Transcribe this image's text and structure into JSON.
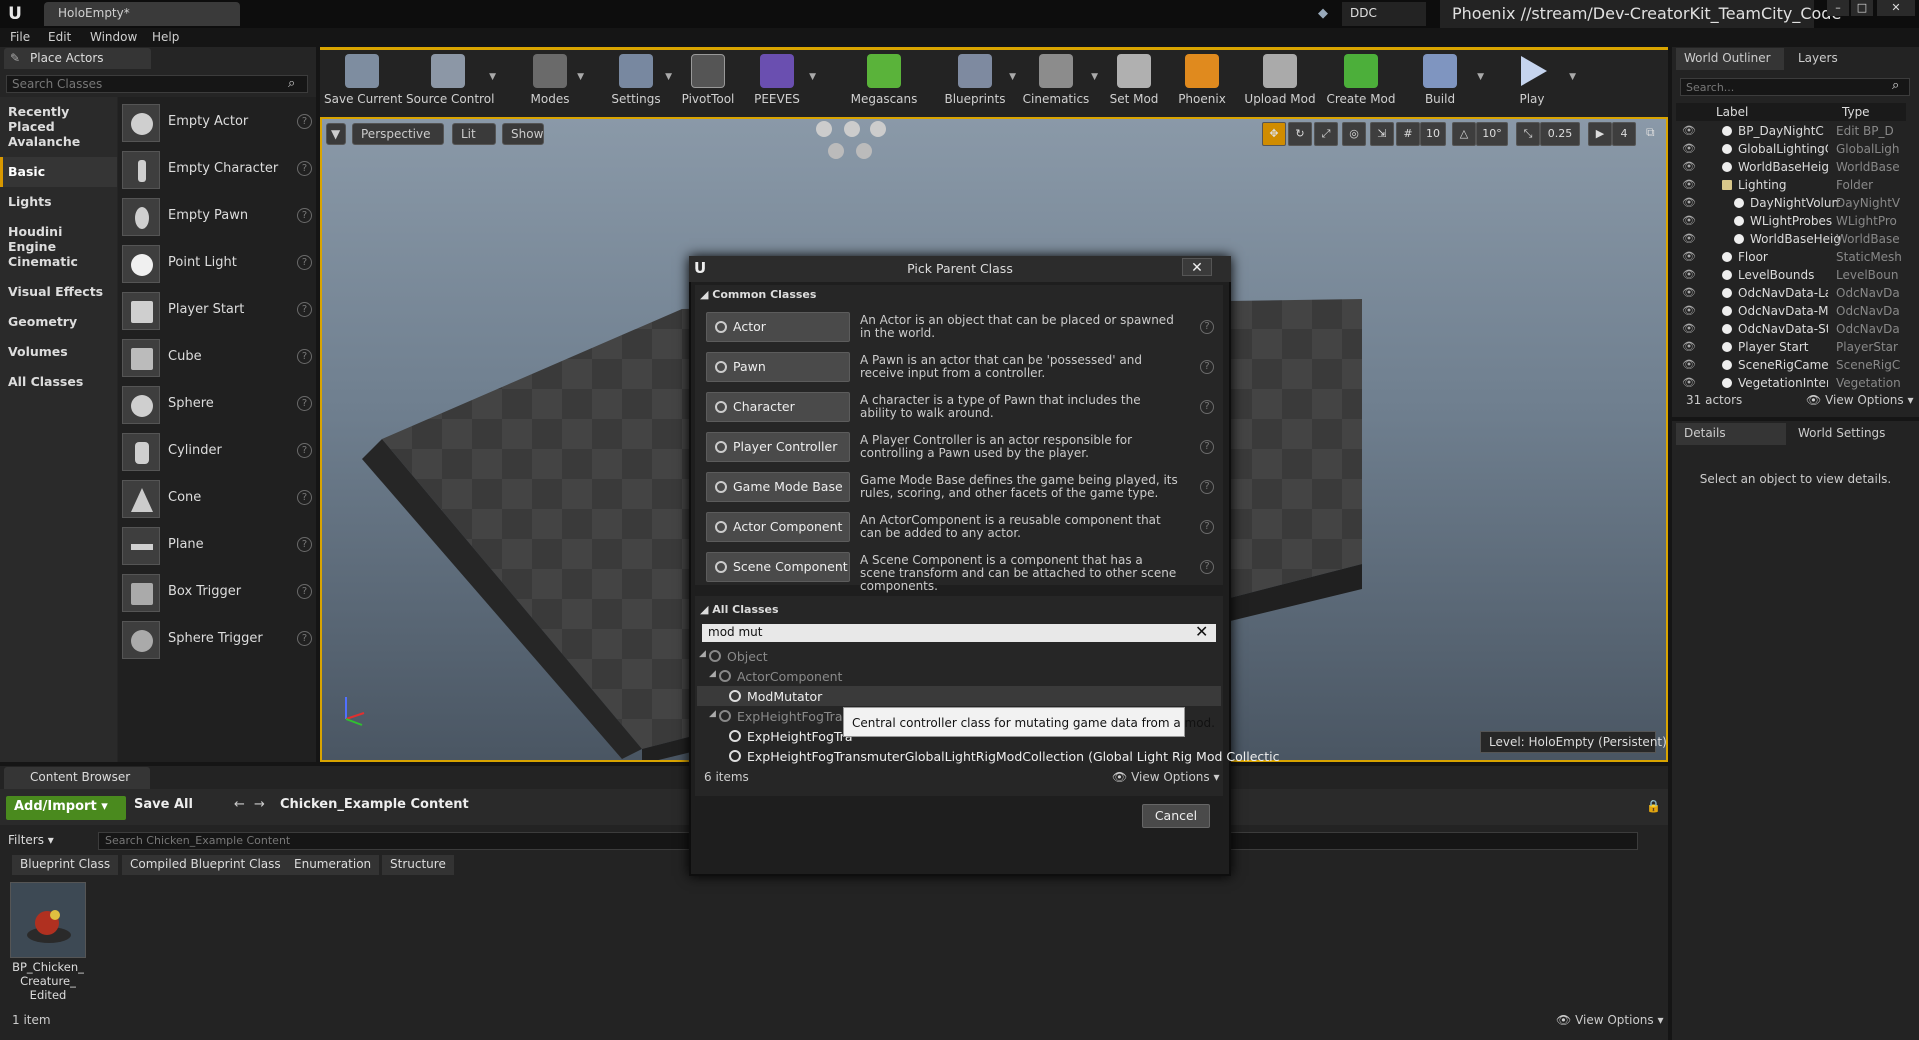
{
  "app": {
    "tab_title": "HoloEmpty*",
    "ddc_label": "DDC",
    "project_name": "Phoenix //stream/Dev-CreatorKit_TeamCity_Code"
  },
  "menu": [
    "File",
    "Edit",
    "Window",
    "Help"
  ],
  "place_actors": {
    "tab_label": "Place Actors",
    "search_placeholder": "Search Classes",
    "categories": [
      "Recently Placed",
      "Avalanche",
      "Basic",
      "Lights",
      "Houdini Engine",
      "Cinematic",
      "Visual Effects",
      "Geometry",
      "Volumes",
      "All Classes"
    ],
    "selected_category": "Basic",
    "items": [
      "Empty Actor",
      "Empty Character",
      "Empty Pawn",
      "Point Light",
      "Player Start",
      "Cube",
      "Sphere",
      "Cylinder",
      "Cone",
      "Plane",
      "Box Trigger",
      "Sphere Trigger"
    ]
  },
  "toolbar": {
    "buttons": [
      "Save Current",
      "Source Control",
      "Modes",
      "Settings",
      "PivotTool",
      "PEEVES",
      "Megascans",
      "Blueprints",
      "Cinematics",
      "Set Mod",
      "Phoenix",
      "Upload Mod",
      "Create Mod",
      "Build",
      "Play"
    ]
  },
  "viewport": {
    "view_mode": "Perspective",
    "lighting": "Lit",
    "show": "Show",
    "grid_snap": "10",
    "rotation_snap": "10°",
    "scale_snap": "0.25",
    "camera_speed": "4",
    "level_label": "Level:  HoloEmpty (Persistent)"
  },
  "outliner": {
    "tab_label": "World Outliner",
    "layers_tab": "Layers",
    "search_placeholder": "Search...",
    "col_label": "Label",
    "col_type": "Type",
    "rows": [
      {
        "name": "BP_DayNightC",
        "type": "Edit BP_D"
      },
      {
        "name": "GlobalLightingC",
        "type": "GlobalLigh"
      },
      {
        "name": "WorldBaseHeig",
        "type": "WorldBase"
      },
      {
        "name": "Lighting",
        "type": "Folder"
      },
      {
        "name": "DayNightVolum",
        "type": "DayNightV"
      },
      {
        "name": "WLightProbes",
        "type": "WLightPro"
      },
      {
        "name": "WorldBaseHeig",
        "type": "WorldBase"
      },
      {
        "name": "Floor",
        "type": "StaticMesh"
      },
      {
        "name": "LevelBounds",
        "type": "LevelBoun"
      },
      {
        "name": "OdcNavData-Lar",
        "type": "OdcNavDa"
      },
      {
        "name": "OdcNavData-Me",
        "type": "OdcNavDa"
      },
      {
        "name": "OdcNavData-Std",
        "type": "OdcNavDa"
      },
      {
        "name": "Player Start",
        "type": "PlayerStar"
      },
      {
        "name": "SceneRigCamera",
        "type": "SceneRigC"
      },
      {
        "name": "VegetationIntera",
        "type": "Vegetation"
      }
    ],
    "actor_count": "31 actors",
    "view_options": "View Options"
  },
  "details": {
    "tab_label": "Details",
    "world_settings_tab": "World Settings",
    "empty_message": "Select an object to view details."
  },
  "content_browser": {
    "tab_label": "Content Browser",
    "add_import": "Add/Import",
    "save_all": "Save All",
    "path": "Chicken_Example Content",
    "filters": "Filters",
    "search_placeholder": "Search Chicken_Example Content",
    "filter_chips": [
      "Blueprint Class",
      "Compiled Blueprint Class",
      "Enumeration",
      "Structure"
    ],
    "asset_name": "BP_Chicken_ Creature_ Edited",
    "item_count": "1 item",
    "view_options": "View Options"
  },
  "modal": {
    "title": "Pick Parent Class",
    "common_header": "Common Classes",
    "common_classes": [
      {
        "label": "Actor",
        "desc": "An Actor is an object that can be placed or spawned in the world."
      },
      {
        "label": "Pawn",
        "desc": "A Pawn is an actor that can be 'possessed' and receive input from a controller."
      },
      {
        "label": "Character",
        "desc": "A character is a type of Pawn that includes the ability to walk around."
      },
      {
        "label": "Player Controller",
        "desc": "A Player Controller is an actor responsible for controlling a Pawn used by the player."
      },
      {
        "label": "Game Mode Base",
        "desc": "Game Mode Base defines the game being played, its rules, scoring, and other facets of the game type."
      },
      {
        "label": "Actor Component",
        "desc": "An ActorComponent is a reusable component that can be added to any actor."
      },
      {
        "label": "Scene Component",
        "desc": "A Scene Component is a component that has a scene transform and can be attached to other scene components."
      }
    ],
    "all_header": "All Classes",
    "search_value": "mod mut",
    "tree": [
      {
        "label": "Object",
        "indent": 0,
        "dim": true
      },
      {
        "label": "ActorComponent",
        "indent": 1,
        "dim": true
      },
      {
        "label": "ModMutator",
        "indent": 2,
        "dim": false
      },
      {
        "label": "ExpHeightFogTrans",
        "indent": 1,
        "dim": true
      },
      {
        "label": "ExpHeightFogTra",
        "indent": 2,
        "dim": false
      },
      {
        "label": "ExpHeightFogTransmuterGlobalLightRigModCollection (Global Light Rig Mod Collectic",
        "indent": 2,
        "dim": false
      }
    ],
    "tooltip": "Central controller class for mutating game data from a mod.",
    "items_count": "6 items",
    "view_options": "View Options",
    "cancel": "Cancel"
  }
}
